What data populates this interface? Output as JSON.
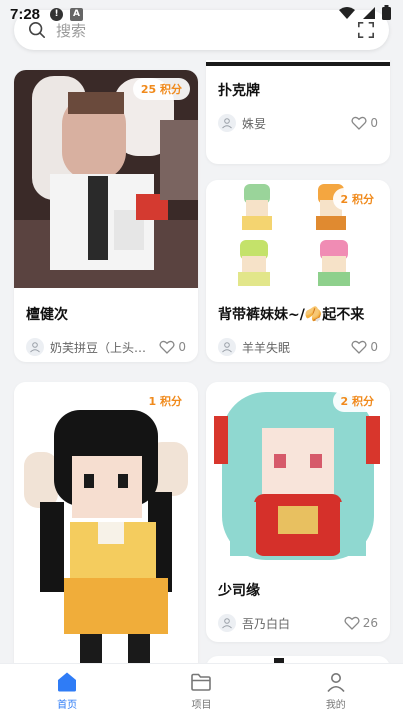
{
  "status": {
    "time": "7:28"
  },
  "search": {
    "placeholder": "搜索"
  },
  "cards": [
    {
      "title": "檀健次",
      "author": "奶芙拼豆（上头版...",
      "likes": "0",
      "badge": "25 积分"
    },
    {
      "title": "扑克牌",
      "author": "姝妟",
      "likes": "0",
      "badge": ""
    },
    {
      "title": "背带裤妹妹~/🥠起不来",
      "author": "羊羊失眠",
      "likes": "0",
      "badge": "2 积分"
    },
    {
      "title": "",
      "author": "",
      "likes": "",
      "badge": "1 积分"
    },
    {
      "title": "少司缘",
      "author": "吾乃白白",
      "likes": "26",
      "badge": "2 积分"
    }
  ],
  "tabs": [
    {
      "label": "首页",
      "icon": "home-icon",
      "active": true
    },
    {
      "label": "项目",
      "icon": "folder-icon",
      "active": false
    },
    {
      "label": "我的",
      "icon": "user-icon",
      "active": false
    }
  ],
  "colors": {
    "accent": "#2f7cf6",
    "badge": "#f08a1c",
    "background": "#f2f3f5"
  }
}
